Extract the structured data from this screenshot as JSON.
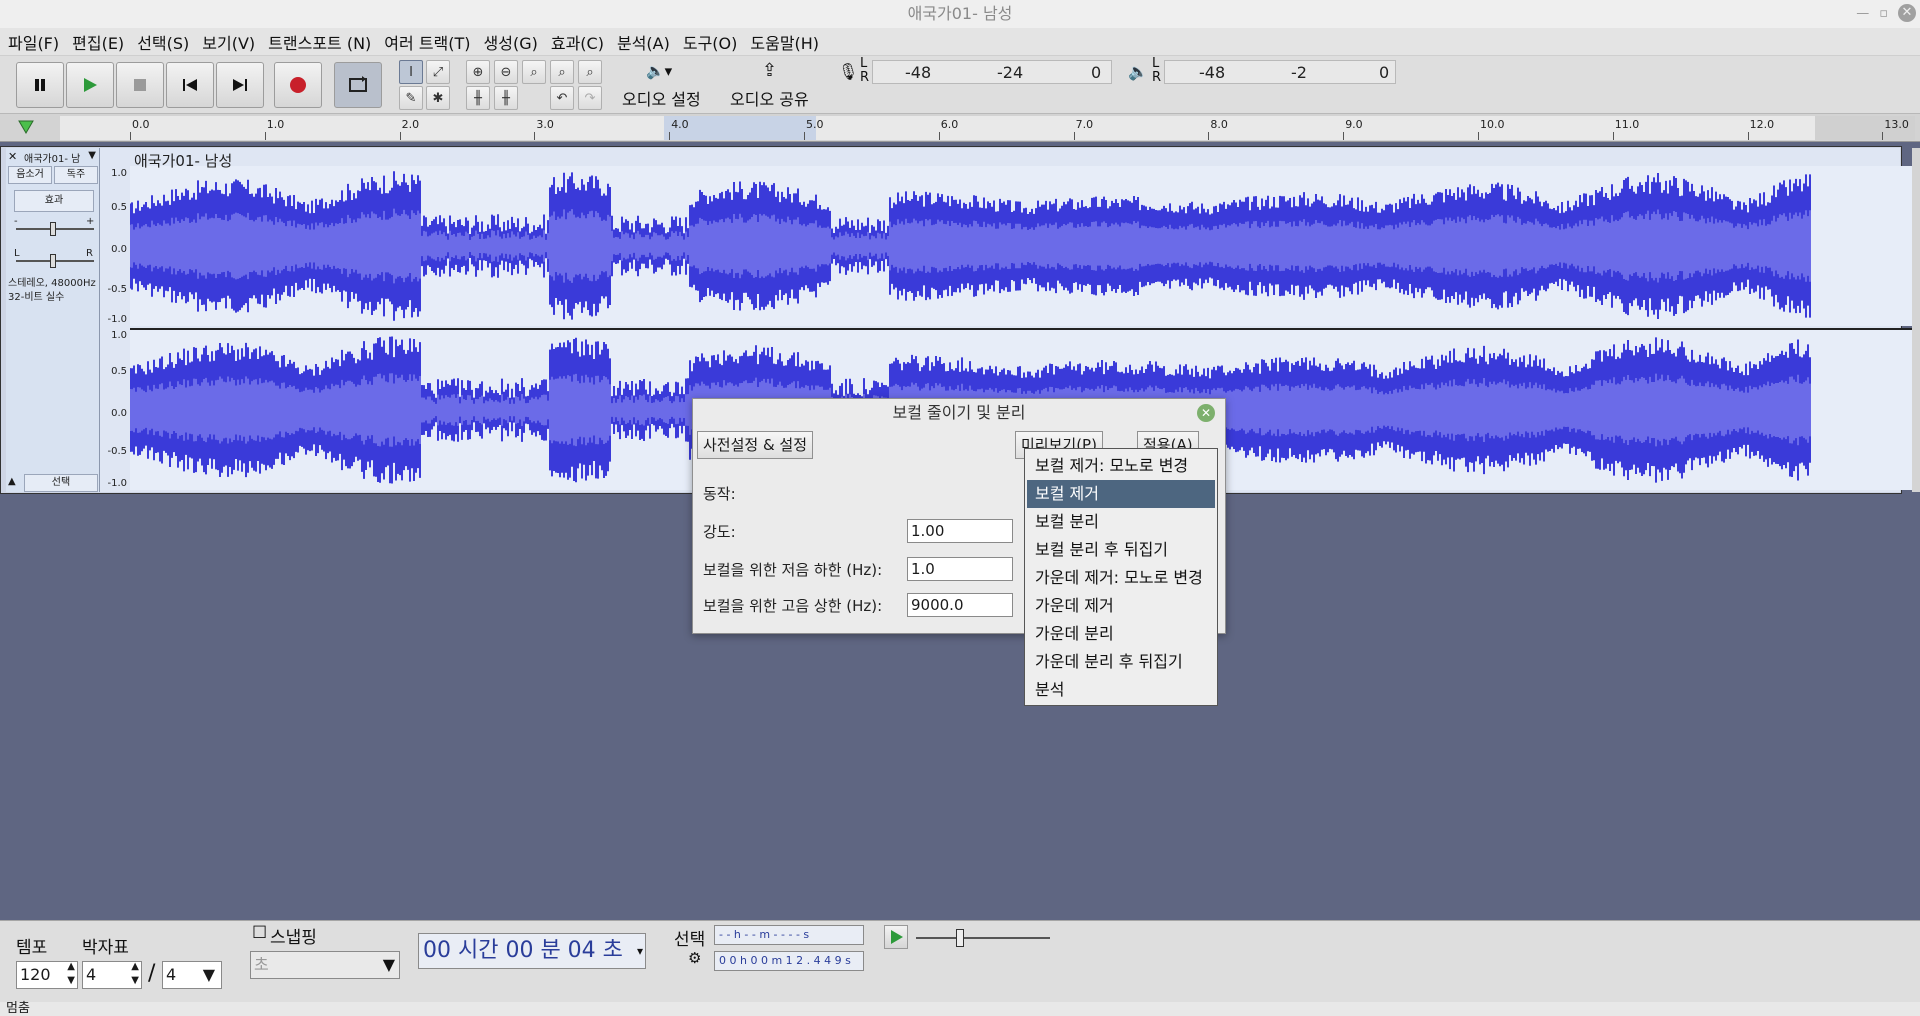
{
  "window": {
    "title": "애국가01- 남성"
  },
  "menu": [
    "파일(F)",
    "편집(E)",
    "선택(S)",
    "보기(V)",
    "트랜스포트 (N)",
    "여러 트랙(T)",
    "생성(G)",
    "효과(C)",
    "분석(A)",
    "도구(O)",
    "도움말(H)"
  ],
  "toolbar": {
    "audio_setup": "오디오 설정",
    "audio_share": "오디오 공유",
    "rec_meter": [
      "-48",
      "-24",
      "0"
    ],
    "play_meter": [
      "-48",
      "-2",
      "0"
    ],
    "lr": [
      "L",
      "R"
    ]
  },
  "ruler": {
    "ticks": [
      "0.0",
      "1.0",
      "2.0",
      "3.0",
      "4.0",
      "5.0",
      "6.0",
      "7.0",
      "8.0",
      "9.0",
      "10.0",
      "11.0",
      "12.0",
      "13.0"
    ]
  },
  "track": {
    "name": "애국가01- 남성",
    "short_name": "애국가01- 남",
    "mute": "음소거",
    "solo": "독주",
    "effects": "효과",
    "gain_minus": "-",
    "gain_plus": "+",
    "pan_l": "L",
    "pan_r": "R",
    "info1": "스테레오, 48000Hz",
    "info2": "32-비트 실수",
    "select": "선택",
    "scale": [
      "1.0",
      "0.5",
      "0.0",
      "-0.5",
      "-1.0"
    ]
  },
  "dialog": {
    "title": "보컬 줄이기 및 분리",
    "presets": "사전설정 & 설정",
    "preview": "미리보기(P)",
    "apply": "적용(A)",
    "action_label": "동작:",
    "strength_label": "강도:",
    "strength_value": "1.00",
    "low_label": "보컬을 위한 저음 하한 (Hz):",
    "low_value": "1.0",
    "high_label": "보컬을 위한 고음 상한 (Hz):",
    "high_value": "9000.0"
  },
  "dropdown": {
    "items": [
      "보컬 제거: 모노로 변경",
      "보컬 제거",
      "보컬 분리",
      "보컬 분리 후 뒤집기",
      "가운데 제거: 모노로 변경",
      "가운데 제거",
      "가운데 분리",
      "가운데 분리 후 뒤집기",
      "분석"
    ],
    "selected": 1
  },
  "bottom": {
    "tempo_label": "템포",
    "tempo_value": "120",
    "time_sig_label": "박자표",
    "time_sig_num": "4",
    "time_sig_den": "4",
    "snap_label": "스냅핑",
    "snap_unit": "초",
    "time_digits": "00 시간 00 분 04 초",
    "selection_label": "선택",
    "sel_start": "- - h - - m - - - - s",
    "sel_end": "0 0 h 0 0 m 1 2 . 4 4 9 s"
  },
  "status": {
    "text": "멈춤"
  },
  "colors": {
    "waveform": "#3a3ad9",
    "waveform_rms": "#6b6be8",
    "background": "#5f6682"
  }
}
